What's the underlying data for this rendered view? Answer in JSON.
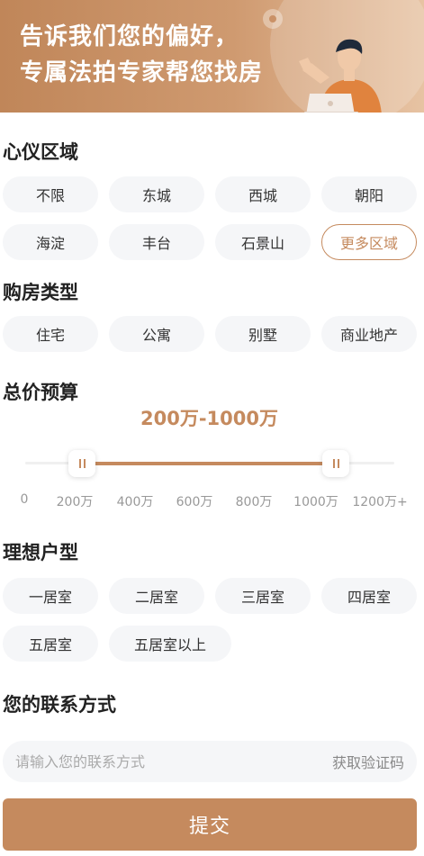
{
  "banner": {
    "line1": "告诉我们您的偏好，",
    "line2": "专属法拍专家帮您找房"
  },
  "colors": {
    "accent": "#c58a5e",
    "chip_bg": "#f5f6f8",
    "banner_start": "#c08659",
    "banner_end": "#e7c3a3"
  },
  "areas": {
    "title": "心仪区域",
    "options": [
      "不限",
      "东城",
      "西城",
      "朝阳",
      "海淀",
      "丰台",
      "石景山"
    ],
    "more_label": "更多区域"
  },
  "house_types": {
    "title": "购房类型",
    "options": [
      "住宅",
      "公寓",
      "别墅",
      "商业地产"
    ]
  },
  "budget": {
    "title": "总价预算",
    "range_label": "200万-1000万",
    "min_value": 200,
    "max_value": 1000,
    "scale_max": 1200,
    "ticks": [
      "0",
      "200万",
      "400万",
      "600万",
      "800万",
      "1000万",
      "1200万+"
    ]
  },
  "layouts": {
    "title": "理想户型",
    "options": [
      "一居室",
      "二居室",
      "三居室",
      "四居室",
      "五居室",
      "五居室以上"
    ]
  },
  "contact": {
    "title": "您的联系方式",
    "placeholder": "请输入您的联系方式",
    "code_button": "获取验证码"
  },
  "submit_label": "提交"
}
